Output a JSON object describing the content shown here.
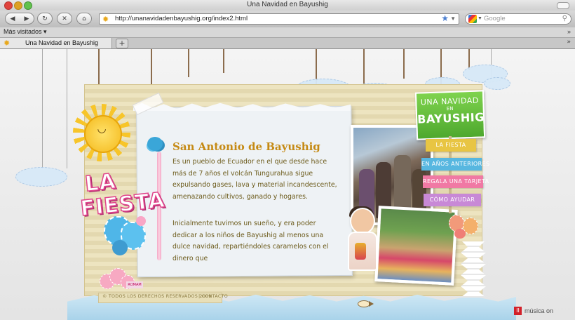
{
  "window": {
    "title": "Una Navidad en Bayushig"
  },
  "toolbar": {
    "back_icon": "◀",
    "forward_icon": "▶",
    "reload_icon": "↻",
    "stop_icon": "✕",
    "home_icon": "⌂",
    "url": "http://unanavidadenbayushig.org/index2.html",
    "search_placeholder": "Google",
    "search_icon": "⚲",
    "bookmark_star": "★",
    "dropdown": "▼"
  },
  "bookmarks_bar": {
    "label": "Más visitados ▾",
    "overflow": "»"
  },
  "tabs": [
    {
      "label": "Una Navidad en Bayushig",
      "close": "✕"
    }
  ],
  "tab_actions": {
    "new_tab": "+",
    "overflow": "»"
  },
  "page": {
    "heading": "San Antonio de Bayushig",
    "paragraph1": "Es un pueblo de Ecuador en el que desde hace más de 7 años el volcán Tungurahua sigue expulsando gases, lava y material incandescente, amenazando cultivos, ganado y hogares.",
    "paragraph2": "Inicialmente tuvimos un sueño, y era poder dedicar a los niños de Bayushig al menos una dulce navidad, repartiéndoles caramelos con el dinero que",
    "logo_line1": "UNA NAVIDAD",
    "logo_line2": "EN",
    "logo_line3": "BAYUSHIG",
    "menu": [
      {
        "label": "LA FIESTA",
        "color": "#e8c543"
      },
      {
        "label": "EN AÑOS ANTERIORES",
        "color": "#57b7e0"
      },
      {
        "label": "REGALA UNA TARJETA",
        "color": "#f079a4"
      },
      {
        "label": "CÓMO AYUDAR",
        "color": "#c889d6"
      }
    ],
    "section_title_line1": "LA",
    "section_title_line2": "FIESTA",
    "sticker_text": "ROMAM",
    "sun_face": "◡",
    "footer_copyright": "© TODOS LOS DERECHOS RESERVADOS 2009",
    "footer_separator": "|",
    "footer_contact": "CONTACTO",
    "music_label": "música on",
    "music_icon": "II"
  },
  "colors": {
    "accent_green": "#5db535",
    "heading_orange": "#c58a14",
    "text_brown": "#6b5a1a",
    "music_red": "#d2212a"
  }
}
